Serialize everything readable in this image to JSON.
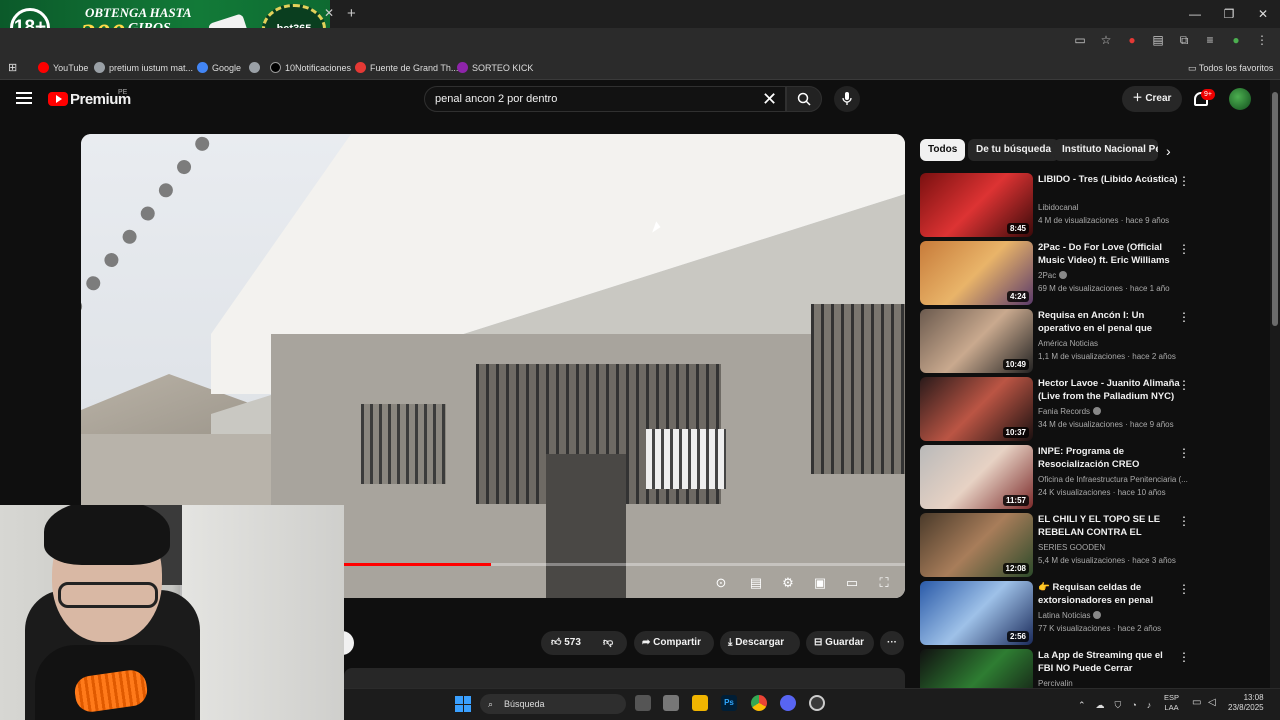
{
  "ad": {
    "age": "18+",
    "line1": "OBTENGA HASTA",
    "line2": "200",
    "line2b": "GIROS GRATIS",
    "brand": "bet365"
  },
  "window": {
    "close_tab": "✕",
    "new_tab": "+",
    "minimize": "—",
    "restore": "❐",
    "close": "✕"
  },
  "bookmarks": [
    {
      "label": "YouTube",
      "color": "#ff0000"
    },
    {
      "label": "pretium iustum mat...",
      "color": "#9aa0a6"
    },
    {
      "label": "Google",
      "color": "#4285f4"
    },
    {
      "label": "",
      "color": "#9aa0a6"
    },
    {
      "label": "10Notificaciones",
      "color": "#000000"
    },
    {
      "label": "Fuente de Grand Th...",
      "color": "#e53935"
    },
    {
      "label": "SORTEO KICK",
      "color": "#8e24aa"
    }
  ],
  "all_favorites": "Todos los favoritos",
  "youtube": {
    "wordmark": "Premium",
    "country": "PE",
    "search_query": "penal ancon 2 por dentro",
    "create_label": "Crear",
    "notif_count": "9+"
  },
  "actions": {
    "likes": "573",
    "share": "Compartir",
    "download": "Descargar",
    "save": "Guardar",
    "more": "···"
  },
  "chips": [
    "Todos",
    "De tu búsqueda",
    "Instituto Nacional Pen"
  ],
  "recommendations": [
    {
      "title": "LIBIDO - Tres (Libido Acústica)",
      "channel": "Libidocanal",
      "meta": "4 M de visualizaciones · hace 9 años",
      "duration": "8:45",
      "verified": false,
      "thumb": "linear-gradient(135deg,#7a1010,#d33 50%,#3a0a0a)"
    },
    {
      "title": "2Pac - Do For Love (Official Music Video) ft. Eric Williams",
      "channel": "2Pac",
      "meta": "69 M de visualizaciones · hace 1 año",
      "duration": "4:24",
      "verified": true,
      "thumb": "linear-gradient(135deg,#c77b3a,#e9b469 50%,#5a3a6a)"
    },
    {
      "title": "Requisa en Ancón I: Un operativo en el penal que acog...",
      "channel": "América Noticias",
      "meta": "1,1 M de visualizaciones · hace 2 años",
      "duration": "10:49",
      "verified": false,
      "thumb": "linear-gradient(135deg,#6b5a4e,#c9a98e 50%,#222)"
    },
    {
      "title": "Hector Lavoe - Juanito Alimaña (Live from the Palladium NYC)",
      "channel": "Fania Records",
      "meta": "34 M de visualizaciones · hace 9 años",
      "duration": "10:37",
      "verified": true,
      "thumb": "linear-gradient(135deg,#2a1a1a,#b54 50%,#1a1010)"
    },
    {
      "title": "INPE: Programa de Resocialización CREO",
      "channel": "Oficina de Infraestructura Penitenciaria (...",
      "meta": "24 K visualizaciones · hace 10 años",
      "duration": "11:57",
      "verified": false,
      "thumb": "linear-gradient(135deg,#b9b9b9,#e7d2c4 50%,#7b2a2a)"
    },
    {
      "title": "EL CHILI Y EL TOPO SE LE REBELAN CONTRA EL PATRÓ...",
      "channel": "SERIES GOODEN",
      "meta": "5,4 M de visualizaciones · hace 3 años",
      "duration": "12:08",
      "verified": false,
      "thumb": "linear-gradient(135deg,#4a3a2a,#a87d5a 50%,#2c4a2a)"
    },
    {
      "title": "👉 Requisan celdas de extorsionadores en penal Anc...",
      "channel": "Latina Noticias",
      "meta": "77 K visualizaciones · hace 2 años",
      "duration": "2:56",
      "verified": true,
      "thumb": "linear-gradient(135deg,#2a5aa8,#9ec1e8 50%,#1a2a5a)"
    },
    {
      "title": "La App de Streaming que el FBI NO Puede Cerrar",
      "channel": "Percivalin",
      "meta": "",
      "duration": "",
      "verified": false,
      "thumb": "linear-gradient(135deg,#111,#2e7d32 50%,#111)"
    }
  ],
  "taskbar": {
    "search": "Búsqueda",
    "lang_1": "ESP",
    "lang_2": "LAA",
    "time": "13:08",
    "date": "23/8/2025"
  }
}
